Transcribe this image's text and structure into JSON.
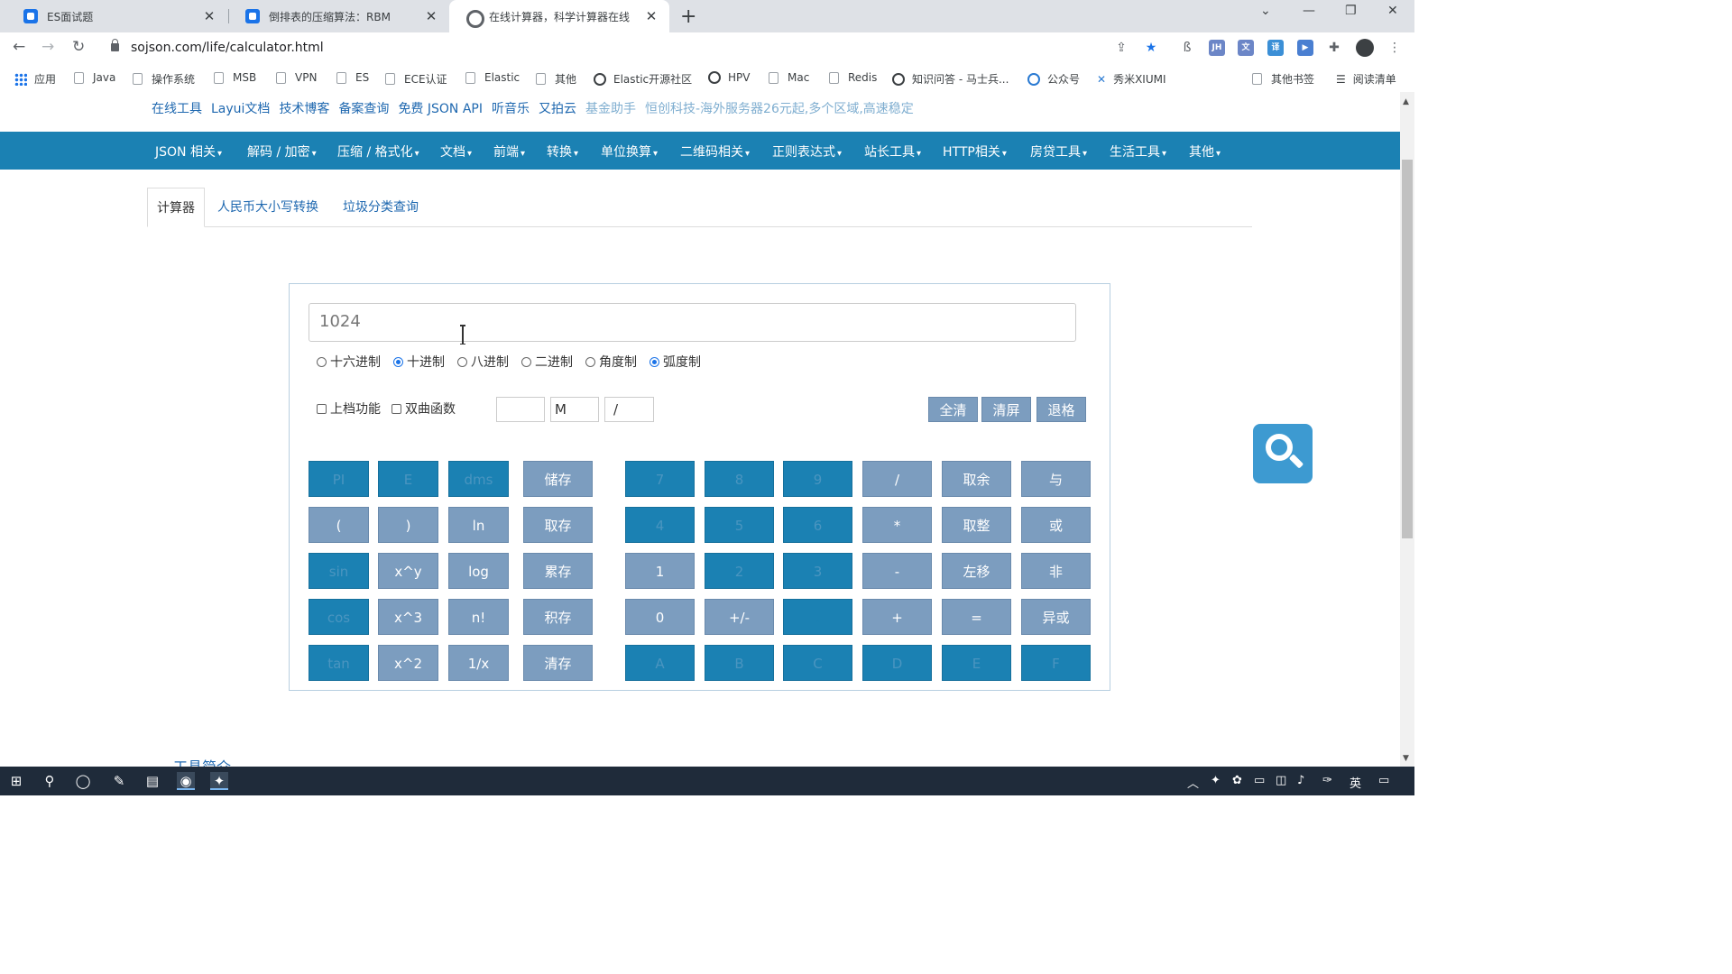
{
  "tabs": [
    {
      "title": "ES面试题",
      "active": false
    },
    {
      "title": "倒排表的压缩算法：RBM",
      "active": false
    },
    {
      "title": "在线计算器，科学计算器在线",
      "active": true
    }
  ],
  "new_tab_symbol": "+",
  "url": "sojson.com/life/calculator.html",
  "bookmarks": {
    "apps": "应用",
    "items": [
      "Java",
      "操作系统",
      "MSB",
      "VPN",
      "ES",
      "ECE认证",
      "Elastic",
      "其他",
      "Elastic开源社区",
      "HPV",
      "Mac",
      "Redis",
      "知识问答 - 马士兵...",
      "公众号",
      "秀米XIUMI"
    ],
    "other": "其他书签",
    "reading": "阅读清单"
  },
  "top_links": [
    "在线工具",
    "Layui文档",
    "技术博客",
    "备案查询",
    "免费 JSON API",
    "听音乐",
    "又拍云",
    "基金助手",
    "恒创科技-海外服务器26元起,多个区域,高速稳定"
  ],
  "main_nav": [
    "JSON 相关",
    "解码 / 加密",
    "压缩 / 格式化",
    "文档",
    "前端",
    "转换",
    "单位换算",
    "二维码相关",
    "正则表达式",
    "站长工具",
    "HTTP相关",
    "房贷工具",
    "生活工具",
    "其他"
  ],
  "sub_tabs": [
    "计算器",
    "人民币大小写转换",
    "垃圾分类查询"
  ],
  "calculator": {
    "display_value": "1024",
    "radios": [
      {
        "label": "十六进制",
        "checked": false
      },
      {
        "label": "十进制",
        "checked": true
      },
      {
        "label": "八进制",
        "checked": false
      },
      {
        "label": "二进制",
        "checked": false
      },
      {
        "label": "角度制",
        "checked": false
      },
      {
        "label": "弧度制",
        "checked": true
      }
    ],
    "checkboxes": [
      {
        "label": "上档功能",
        "checked": false
      },
      {
        "label": "双曲函数",
        "checked": false
      }
    ],
    "memory_box": "",
    "memory_flag": "M",
    "bracket_box": "/",
    "control_buttons": [
      "全清",
      "清屏",
      "退格"
    ],
    "left_rows": [
      [
        "PI",
        "E",
        "dms",
        "储存"
      ],
      [
        "(",
        ")",
        "ln",
        "取存"
      ],
      [
        "sin",
        "x^y",
        "log",
        "累存"
      ],
      [
        "cos",
        "x^3",
        "n!",
        "积存"
      ],
      [
        "tan",
        "x^2",
        "1/x",
        "清存"
      ]
    ],
    "right_rows": [
      [
        "7",
        "8",
        "9",
        "/",
        "取余",
        "与"
      ],
      [
        "4",
        "5",
        "6",
        "*",
        "取整",
        "或"
      ],
      [
        "1",
        "2",
        "3",
        "-",
        "左移",
        "非"
      ],
      [
        "0",
        "+/-",
        ".",
        "+",
        "=",
        "异或"
      ],
      [
        "A",
        "B",
        "C",
        "D",
        "E",
        "F"
      ]
    ]
  },
  "tool_intro": "工具简介",
  "taskbar": {
    "ime": "英"
  }
}
